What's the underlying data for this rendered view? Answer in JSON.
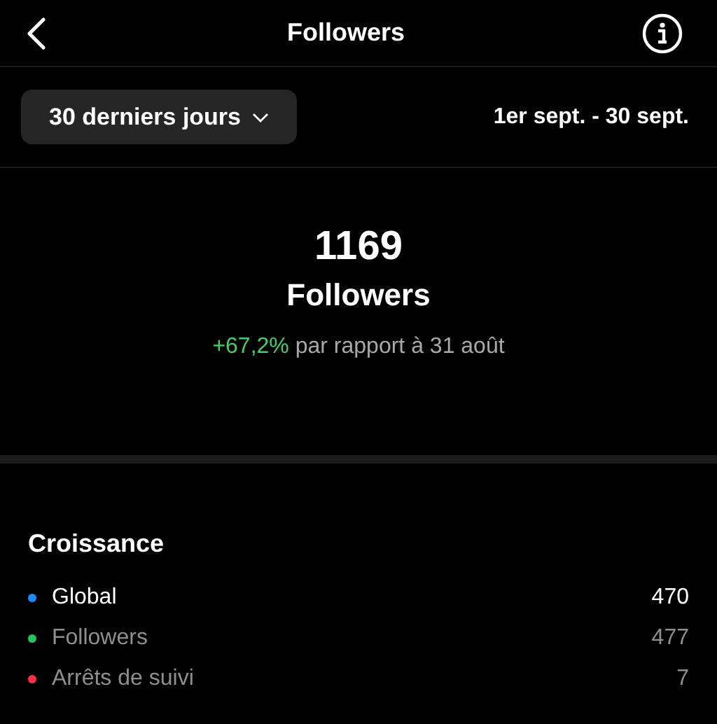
{
  "header": {
    "title": "Followers"
  },
  "period": {
    "label": "30 derniers jours",
    "range": "1er sept. - 30 sept."
  },
  "summary": {
    "count": "1169",
    "label": "Followers",
    "change": "+67,2%",
    "comparison": "par rapport à 31 août"
  },
  "growth": {
    "title": "Croissance",
    "items": [
      {
        "label": "Global",
        "value": "470",
        "color": "#1a8cff",
        "selected": true
      },
      {
        "label": "Followers",
        "value": "477",
        "color": "#22c55e",
        "selected": false
      },
      {
        "label": "Arrêts de suivi",
        "value": "7",
        "color": "#ff3040",
        "selected": false
      }
    ]
  }
}
